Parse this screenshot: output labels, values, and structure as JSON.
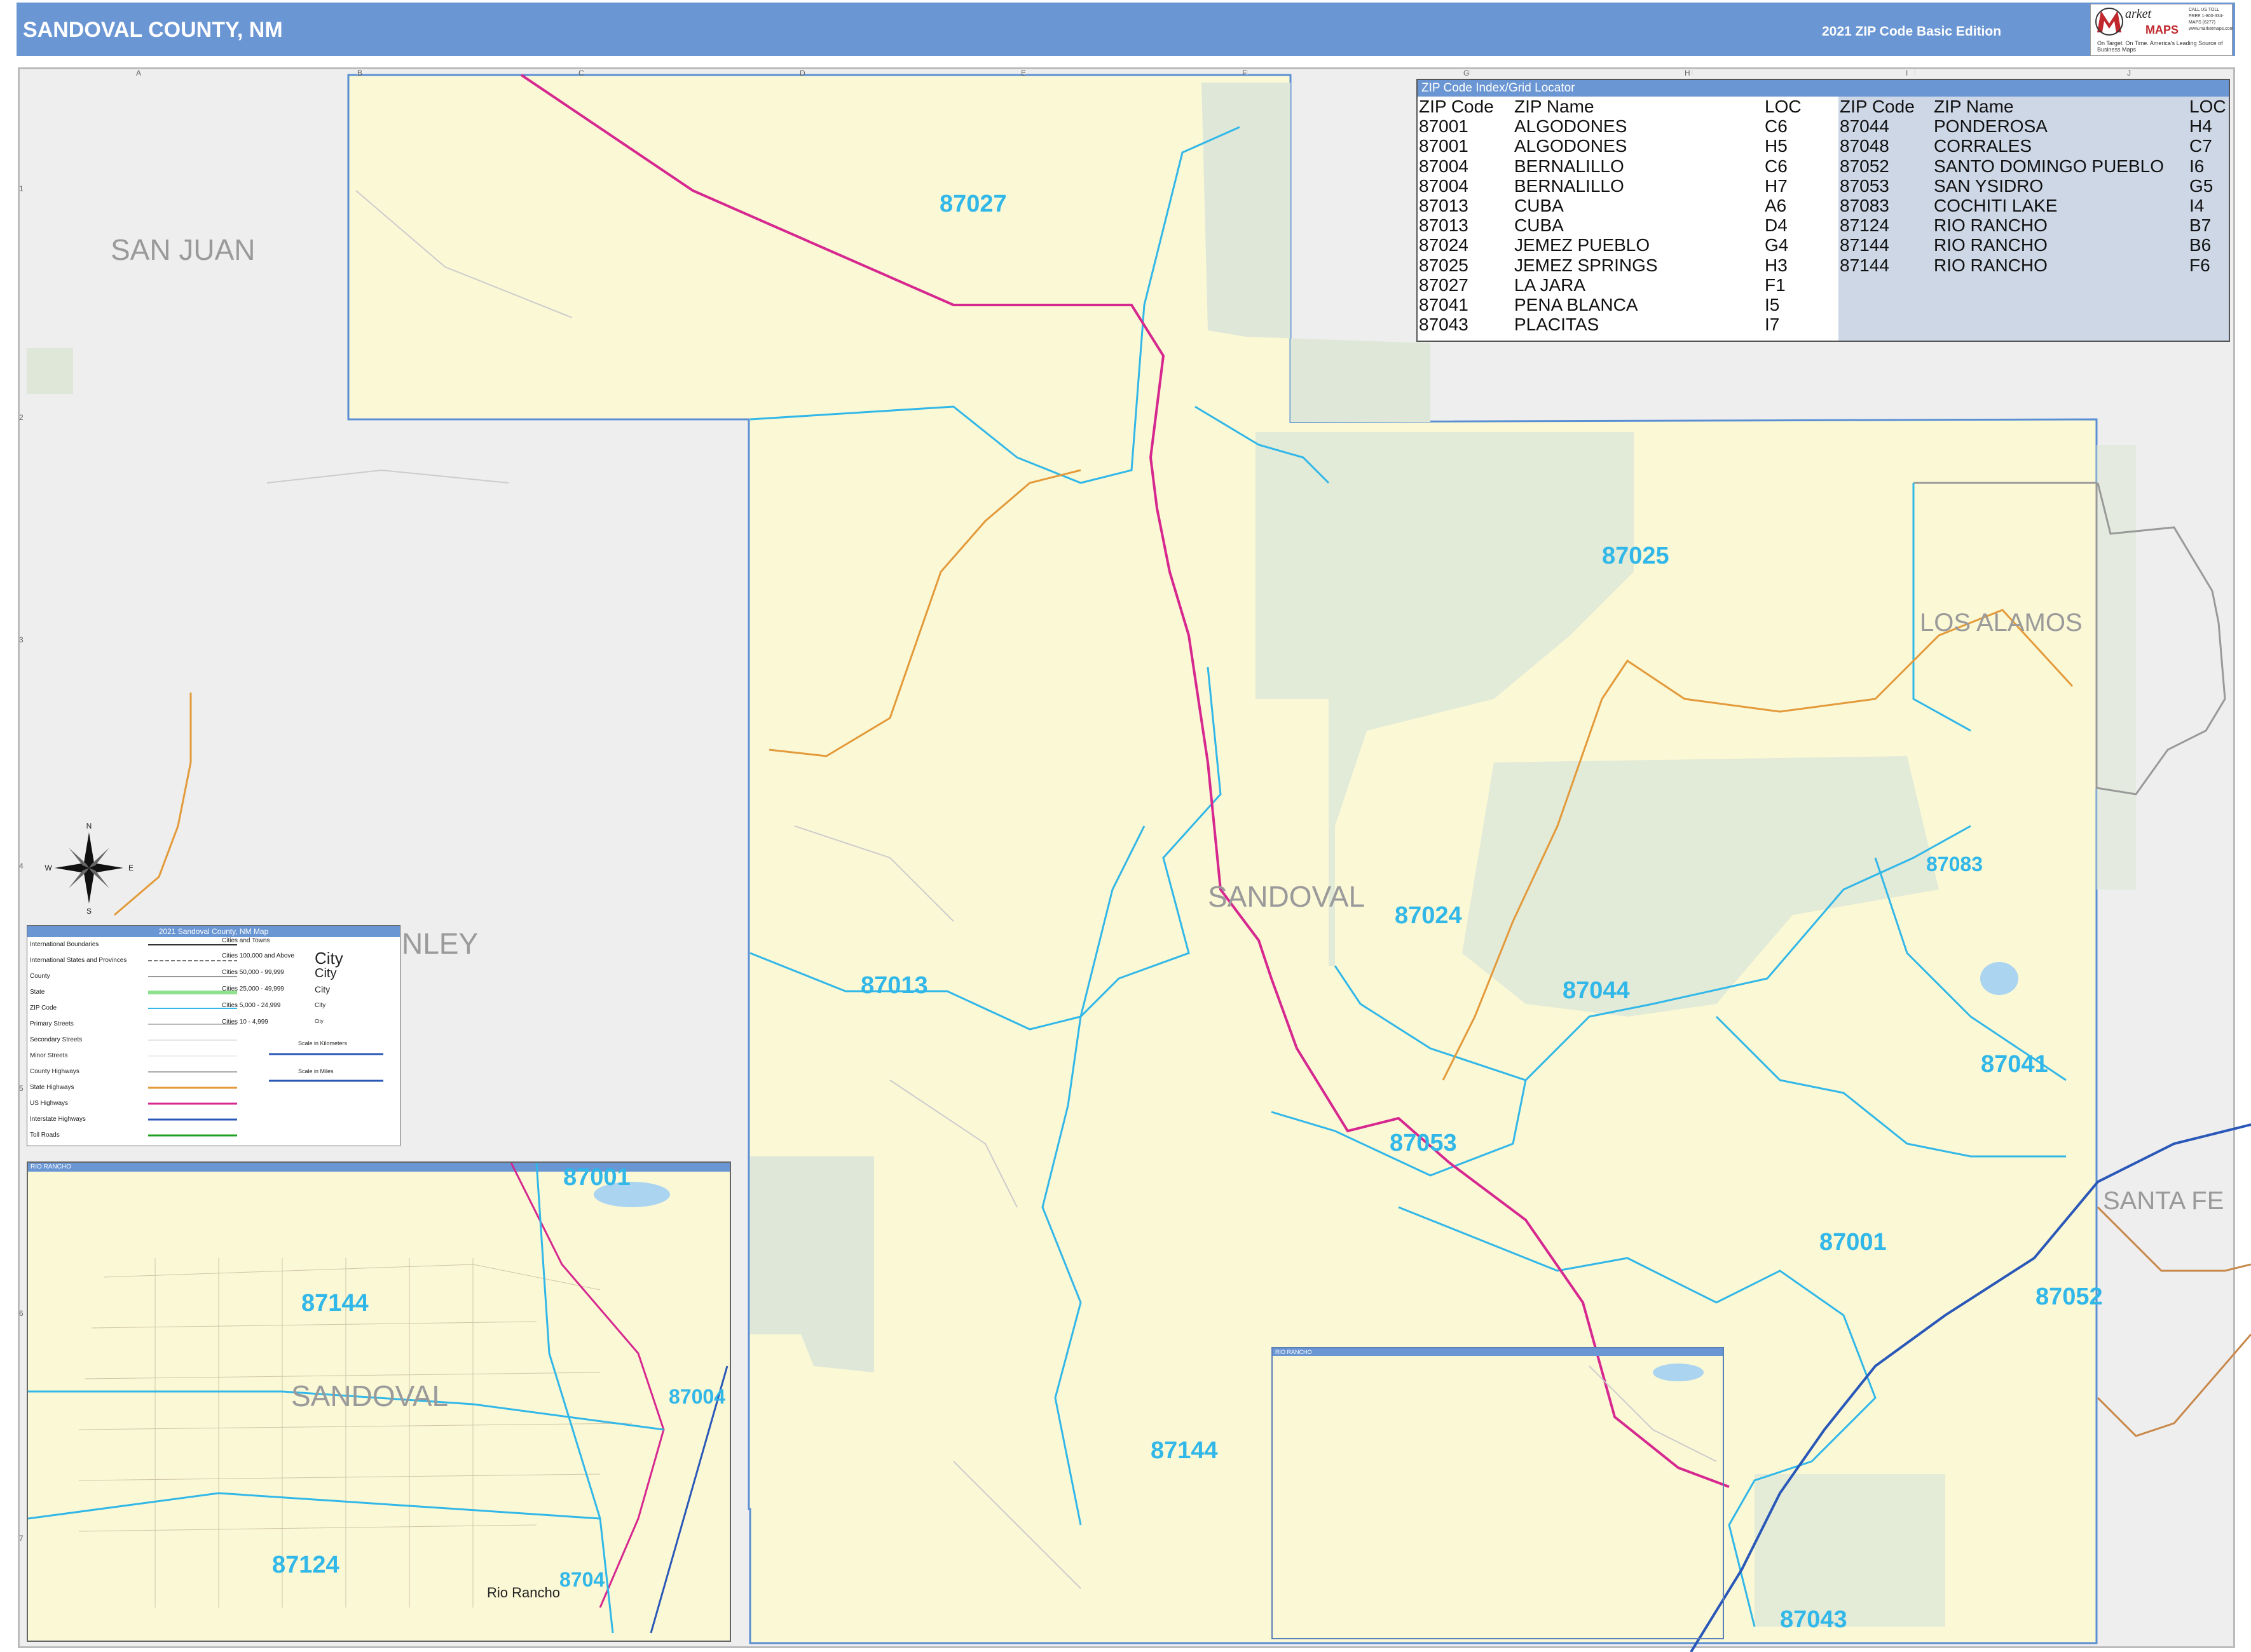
{
  "header": {
    "title": "SANDOVAL COUNTY, NM",
    "edition": "2021 ZIP Code Basic Edition",
    "logo_word": "arket",
    "logo_maps": "MAPS",
    "logo_tag": "On Target. On Time. America's Leading Source of Business Maps",
    "logo_contact": "CALL US TOLL FREE 1-800-334-MAPS (6277) www.marketmaps.com"
  },
  "grid": {
    "columns": [
      "A",
      "B",
      "C",
      "D",
      "E",
      "F",
      "G",
      "H",
      "I",
      "J"
    ],
    "rows": [
      "1",
      "2",
      "3",
      "4",
      "5",
      "6",
      "7"
    ]
  },
  "counties": {
    "san_juan": "SAN JUAN",
    "mckinley": "NLEY",
    "los_alamos": "LOS ALAMOS",
    "santa_fe": "SANTA FE",
    "sandoval_main": "SANDOVAL",
    "sandoval_inset": "SANDOVAL"
  },
  "zips": {
    "z87027": "87027",
    "z87025": "87025",
    "z87013": "87013",
    "z87024": "87024",
    "z87083": "87083",
    "z87044": "87044",
    "z87041": "87041",
    "z87053": "87053",
    "z87001": "87001",
    "z87052": "87052",
    "z87144": "87144",
    "z87043": "87043",
    "inset_87001": "87001",
    "inset_87144": "87144",
    "inset_87004": "87004",
    "inset_87124": "87124",
    "inset_87048": "8704"
  },
  "inset": {
    "title": "RIO RANCHO",
    "city_label": "Rio Rancho"
  },
  "frame2": {
    "title": "RIO RANCHO"
  },
  "compass": {
    "n": "N",
    "s": "S",
    "e": "E",
    "w": "W"
  },
  "zip_index": {
    "title": "ZIP Code Index/Grid Locator",
    "headers": {
      "code": "ZIP Code",
      "name": "ZIP Name",
      "loc": "LOC"
    },
    "left": [
      {
        "code": "87001",
        "name": "ALGODONES",
        "loc": "C6"
      },
      {
        "code": "87001",
        "name": "ALGODONES",
        "loc": "H5"
      },
      {
        "code": "87004",
        "name": "BERNALILLO",
        "loc": "C6"
      },
      {
        "code": "87004",
        "name": "BERNALILLO",
        "loc": "H7"
      },
      {
        "code": "87013",
        "name": "CUBA",
        "loc": "A6"
      },
      {
        "code": "87013",
        "name": "CUBA",
        "loc": "D4"
      },
      {
        "code": "87024",
        "name": "JEMEZ PUEBLO",
        "loc": "G4"
      },
      {
        "code": "87025",
        "name": "JEMEZ SPRINGS",
        "loc": "H3"
      },
      {
        "code": "87027",
        "name": "LA JARA",
        "loc": "F1"
      },
      {
        "code": "87041",
        "name": "PENA BLANCA",
        "loc": "I5"
      },
      {
        "code": "87043",
        "name": "PLACITAS",
        "loc": "I7"
      }
    ],
    "right": [
      {
        "code": "87044",
        "name": "PONDEROSA",
        "loc": "H4"
      },
      {
        "code": "87048",
        "name": "CORRALES",
        "loc": "C7"
      },
      {
        "code": "87052",
        "name": "SANTO DOMINGO PUEBLO",
        "loc": "I6"
      },
      {
        "code": "87053",
        "name": "SAN YSIDRO",
        "loc": "G5"
      },
      {
        "code": "87083",
        "name": "COCHITI LAKE",
        "loc": "I4"
      },
      {
        "code": "87124",
        "name": "RIO RANCHO",
        "loc": "B7"
      },
      {
        "code": "87144",
        "name": "RIO RANCHO",
        "loc": "B6"
      },
      {
        "code": "87144",
        "name": "RIO RANCHO",
        "loc": "F6"
      }
    ]
  },
  "legend": {
    "title": "2021 Sandoval County, NM Map",
    "left_items": [
      "International Boundaries",
      "International States and Provinces",
      "County",
      "State",
      "ZIP Code",
      "Primary Streets",
      "Secondary Streets",
      "Minor Streets",
      "County Highways",
      "State Highways",
      "US Highways",
      "Interstate Highways",
      "Toll Roads"
    ],
    "right_title": "Cities and Towns",
    "right_items": [
      "Cities 100,000 and Above",
      "Cities 50,000 - 99,999",
      "Cities 25,000 - 49,999",
      "Cities 5,000 - 24,999",
      "Cities 10 - 4,999"
    ],
    "city_samples": [
      "City",
      "City",
      "City",
      "City",
      "City"
    ],
    "scale_km": "Scale in Kilometers",
    "scale_mi": "Scale in Miles"
  },
  "colors": {
    "header": "#6a96d4",
    "county_fill": "#fbf8d6",
    "forest": "#dfe8d8",
    "zip_line": "#31b7e8",
    "us_highway": "#d6288f",
    "state_highway": "#e39a3a",
    "interstate": "#2a58b8"
  },
  "icons": [
    "compass-rose-icon",
    "market-maps-logo-icon"
  ]
}
